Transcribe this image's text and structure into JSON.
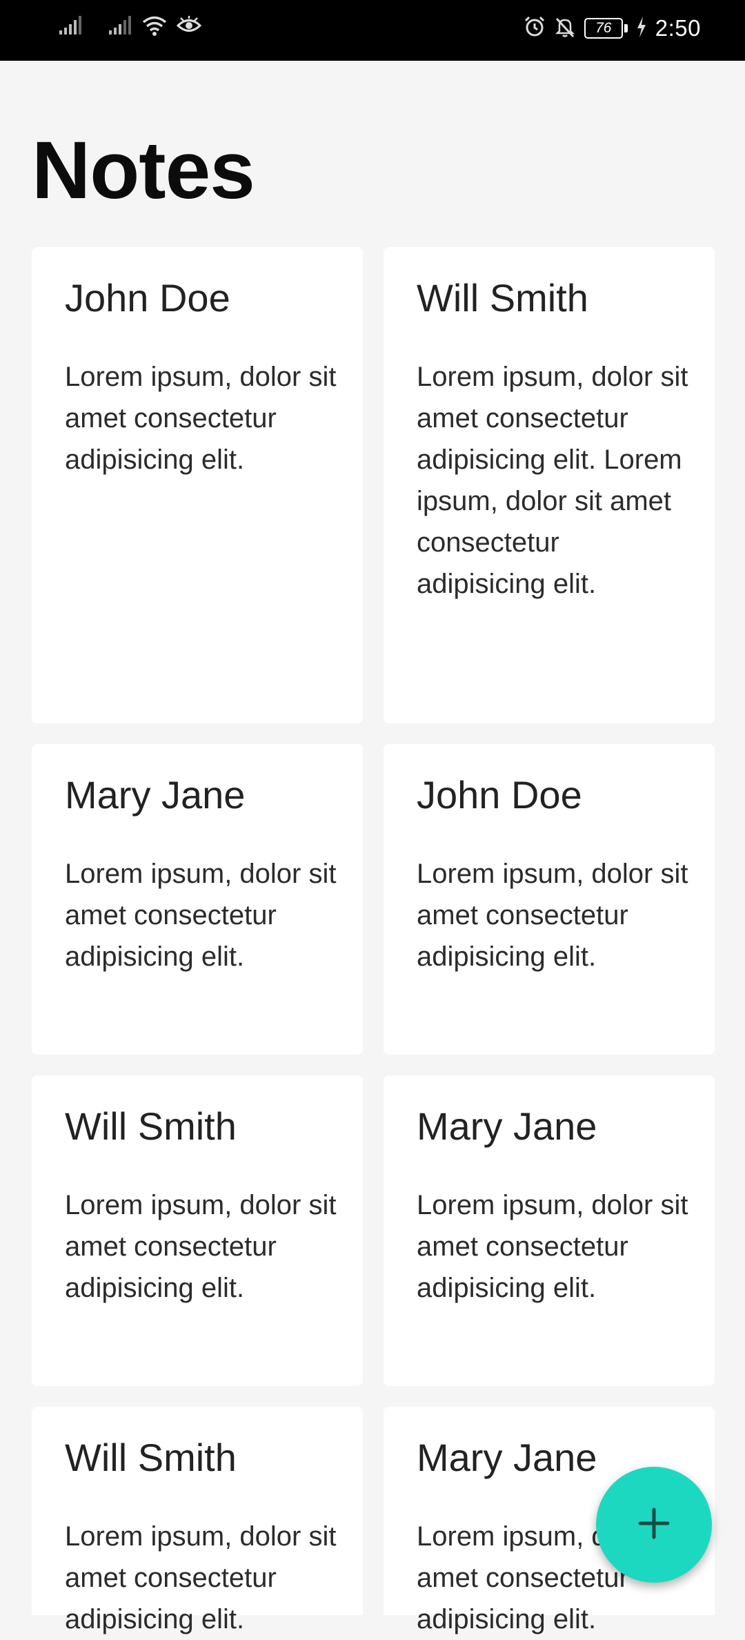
{
  "status_bar": {
    "time": "2:50",
    "battery": "76",
    "icons": [
      "signal-icon",
      "signal-icon",
      "wifi-icon",
      "eye-icon",
      "alarm-icon",
      "bell-off-icon",
      "battery-icon",
      "charging-icon"
    ]
  },
  "header": {
    "title": "Notes"
  },
  "notes": [
    {
      "title": "John Doe",
      "body": "Lorem ipsum, dolor sit amet consectetur adipisicing elit."
    },
    {
      "title": "Will Smith",
      "body": "Lorem ipsum, dolor sit amet consectetur adipisicing elit. Lorem ipsum, dolor sit amet consectetur adipisicing elit."
    },
    {
      "title": "Mary Jane",
      "body": "Lorem ipsum, dolor sit amet consectetur adipisicing elit."
    },
    {
      "title": "John Doe",
      "body": "Lorem ipsum, dolor sit amet consectetur adipisicing elit."
    },
    {
      "title": "Will Smith",
      "body": "Lorem ipsum, dolor sit amet consectetur adipisicing elit."
    },
    {
      "title": "Mary Jane",
      "body": "Lorem ipsum, dolor sit amet consectetur adipisicing elit."
    },
    {
      "title": "Will Smith",
      "body": "Lorem ipsum, dolor sit amet consectetur adipisicing elit."
    },
    {
      "title": "Mary Jane",
      "body": "Lorem ipsum, dolor sit amet consectetur adipisicing elit."
    }
  ],
  "fab": {
    "icon": "plus-icon",
    "color": "#1dd8c1"
  }
}
